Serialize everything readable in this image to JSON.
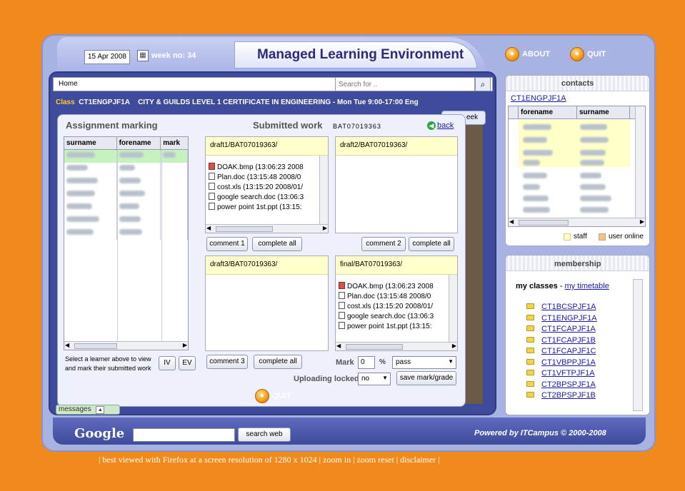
{
  "header": {
    "date": "15 Apr 2008",
    "week": "week no: 34",
    "title": "Managed Learning Environment",
    "about": "ABOUT",
    "quit": "QUIT"
  },
  "nav": {
    "home": "Home",
    "search_placeholder": "Search for .."
  },
  "class_bar": {
    "prefix": "Class",
    "code": "CT1ENGPJF1A",
    "description": "CITY & GUILDS LEVEL 1 CERTIFICATE IN ENGINEERING - Mon Tue 9:00-17:00 Eng"
  },
  "week_tab": "eek",
  "assignment": {
    "title": "Assignment marking",
    "submitted_title": "Submitted work",
    "student_id": "BAT07019363",
    "back": "back",
    "columns": [
      "surname",
      "forename",
      "mark"
    ],
    "hint": "Select a learner above to view and mark their submitted work",
    "iv": "IV",
    "ev": "EV",
    "draft1": {
      "path": "draft1/BAT07019363/",
      "files": [
        "DOAK.bmp (13:06:23 2008",
        "Plan.doc (13:15:48 2008/0",
        "cost.xls (13:15:20 2008/01/",
        "google search.doc (13:06:3",
        "power point 1st.ppt (13:15:"
      ]
    },
    "draft2": {
      "path": "draft2/BAT07019363/"
    },
    "draft3": {
      "path": "draft3/BAT07019363/"
    },
    "final": {
      "path": "final/BAT07019363/",
      "files": [
        "DOAK.bmp (13:06:23 2008",
        "Plan.doc (13:15:48 2008/0",
        "cost.xls (13:15:20 2008/01/",
        "google search.doc (13:06:3",
        "power point 1st.ppt (13:15:"
      ]
    },
    "buttons": {
      "comment1": "comment 1",
      "comment2": "comment 2",
      "comment3": "comment 3",
      "complete_all": "complete all"
    },
    "mark_label": "Mark",
    "mark_value": "0",
    "percent": "%",
    "grade": "pass",
    "uploading_label": "Uploading locked",
    "uploading_value": "no",
    "save": "save mark/grade",
    "quit": "QUIT"
  },
  "messages": "messages",
  "contacts": {
    "title": "contacts",
    "group": "CT1ENGPJF1A",
    "columns": [
      "forename",
      "surname"
    ],
    "legend_staff": "staff",
    "legend_online": "user online",
    "colors": {
      "staff": "#ffffc0",
      "online": "#f2c67a"
    }
  },
  "membership": {
    "title": "membership",
    "my_classes": "my classes",
    "my_timetable": "my timetable",
    "classes": [
      "CT1BCSPJF1A",
      "CT1ENGPJF1A",
      "CT1FCAPJF1A",
      "CT1FCAPJF1B",
      "CT1FCAPJF1C",
      "CT1VBPPJF1A",
      "CT1VFTPJF1A",
      "CT2BPSPJF1A",
      "CT2BPSPJF1B"
    ]
  },
  "bottom": {
    "google": "Google",
    "search_web": "search web",
    "powered": "Powered by ITCampus © 2000-2008"
  },
  "footer": "| best viewed with Firefox at a screen resolution of 1280 x 1024 | zoom in | zoom reset | disclaimer |"
}
